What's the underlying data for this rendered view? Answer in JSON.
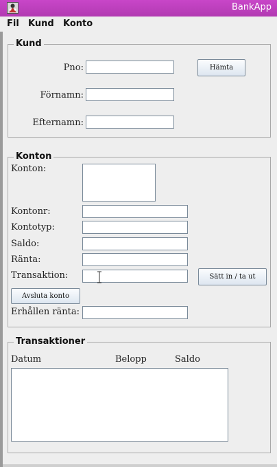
{
  "window": {
    "title": "BankApp"
  },
  "menu": {
    "file": "Fil",
    "customer": "Kund",
    "account": "Konto"
  },
  "kund": {
    "legend": "Kund",
    "pno_label": "Pno:",
    "pno_value": "",
    "fetch_button": "Hämta",
    "firstname_label": "Förnamn:",
    "firstname_value": "",
    "lastname_label": "Efternamn:",
    "lastname_value": ""
  },
  "konton": {
    "legend": "Konton",
    "accounts_label": "Konton:",
    "accountno_label": "Kontonr:",
    "accountno_value": "",
    "accounttype_label": "Kontotyp:",
    "accounttype_value": "",
    "balance_label": "Saldo:",
    "balance_value": "",
    "interest_label": "Ränta:",
    "interest_value": "",
    "transaction_label": "Transaktion:",
    "transaction_value": "",
    "deposit_withdraw_button": "Sätt in / ta ut",
    "close_account_button": "Avsluta konto",
    "received_interest_label": "Erhållen ränta:",
    "received_interest_value": ""
  },
  "transaktioner": {
    "legend": "Transaktioner",
    "columns": [
      "Datum",
      "Belopp",
      "Saldo"
    ]
  }
}
